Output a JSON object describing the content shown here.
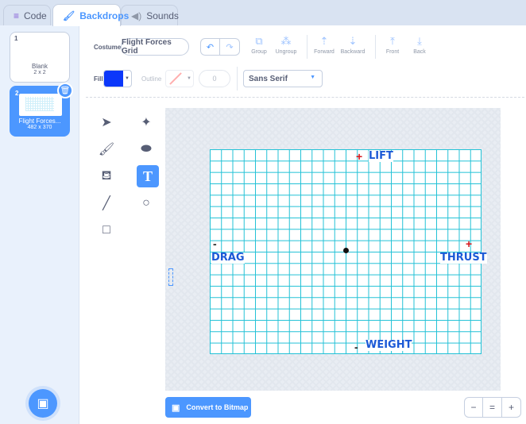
{
  "tabs": [
    {
      "label": "Code",
      "icon": "code-icon"
    },
    {
      "label": "Backdrops",
      "icon": "paintbrush-icon"
    },
    {
      "label": "Sounds",
      "icon": "speaker-icon"
    }
  ],
  "backdrops": [
    {
      "number": "1",
      "name": "Blank",
      "size": "2 x 2"
    },
    {
      "number": "2",
      "name": "Flight Forces...",
      "size": "482 x 370"
    }
  ],
  "toolbar": {
    "costume_label": "Costume",
    "costume_name": "Flight Forces Grid",
    "group": "Group",
    "ungroup": "Ungroup",
    "forward": "Forward",
    "backward": "Backward",
    "front": "Front",
    "back": "Back",
    "fill_label": "Fill",
    "fill_color": "#0b37fa",
    "outline_label": "Outline",
    "outline_width": "0",
    "font": "Sans Serif"
  },
  "stage_text": {
    "lift": "LIFT",
    "drag": "DRAG",
    "thrust": "THRUST",
    "weight": "WEIGHT",
    "plus": "+",
    "minus": "-"
  },
  "bottom": {
    "convert": "Convert to Bitmap",
    "zoom_out": "−",
    "zoom_reset": "=",
    "zoom_in": "+"
  },
  "colors": {
    "accent": "#4c97ff",
    "grid": "#21c1d6",
    "text_blue": "#1b59d6",
    "plus_red": "#d6171c"
  }
}
